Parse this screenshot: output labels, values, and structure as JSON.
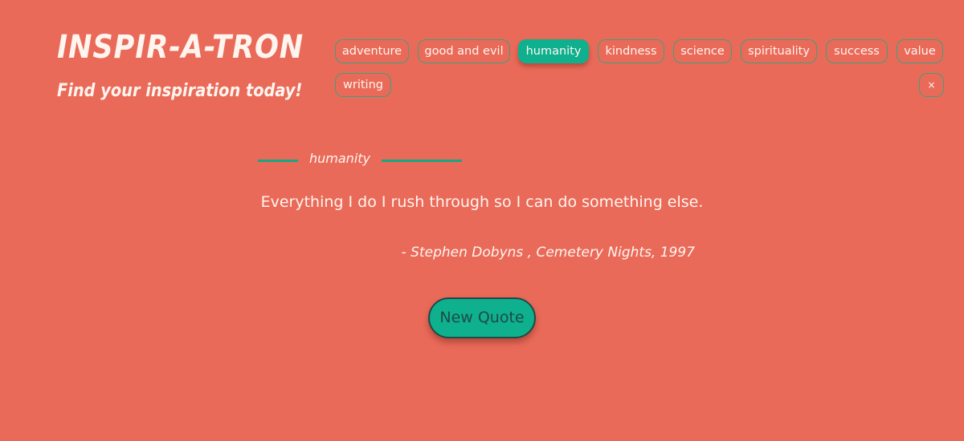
{
  "header": {
    "title": "INSPIR-A-TRON",
    "subtitle": "Find your inspiration today!"
  },
  "tags": {
    "items": [
      {
        "label": "adventure"
      },
      {
        "label": "good and evil"
      },
      {
        "label": "humanity",
        "active": true
      },
      {
        "label": "kindness"
      },
      {
        "label": "science"
      },
      {
        "label": "spirituality"
      },
      {
        "label": "success"
      },
      {
        "label": "value"
      },
      {
        "label": "writing"
      }
    ],
    "clear_label": "×"
  },
  "quote": {
    "category": "humanity",
    "text": "Everything I do I rush through so I can do something else.",
    "source": "- Stephen Dobyns , Cemetery Nights, 1997"
  },
  "actions": {
    "new_quote_label": "New Quote"
  },
  "colors": {
    "background": "#ea6a59",
    "accent": "#0eb08e",
    "tag_border": "#3ea07e",
    "text": "#fff5ef",
    "button_text": "#1f4a47"
  }
}
